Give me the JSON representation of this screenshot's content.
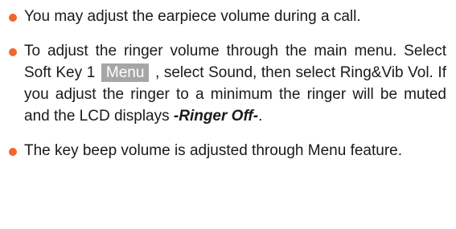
{
  "colors": {
    "bullet": "#f2652f",
    "softkey_bg": "#a6a6a6",
    "softkey_text": "#ffffff",
    "text": "#1a1a1a"
  },
  "items": [
    {
      "text": "You may adjust the earpiece volume during a call."
    },
    {
      "text_before": "To adjust the ringer volume through the main menu. Select Soft Key 1 ",
      "softkey": "Menu",
      "text_middle": " , select Sound, then select Ring&Vib Vol. If you adjust the ringer to a minimum the ringer will be muted and the LCD displays ",
      "display": "-Ringer Off-",
      "text_after": "."
    },
    {
      "text": "The key beep volume is adjusted through Menu feature."
    }
  ]
}
